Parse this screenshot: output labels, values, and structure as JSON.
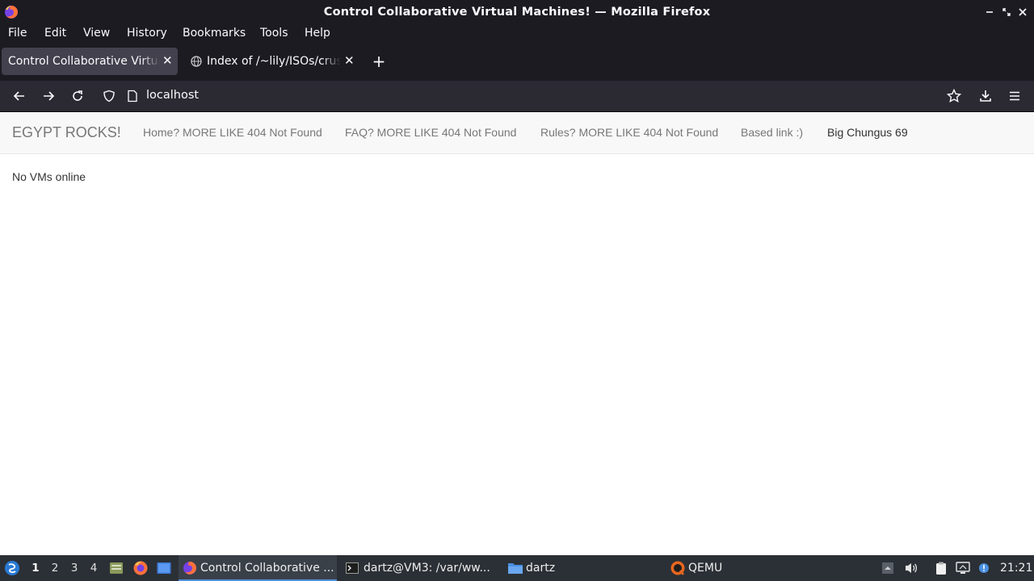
{
  "window": {
    "title": "Control Collaborative Virtual Machines! — Mozilla Firefox"
  },
  "menu": {
    "file": "File",
    "edit": "Edit",
    "view": "View",
    "history": "History",
    "bookmarks": "Bookmarks",
    "tools": "Tools",
    "help": "Help"
  },
  "tabs": [
    {
      "label": "Control Collaborative Virtual Machines!",
      "active": true
    },
    {
      "label": "Index of /~lily/ISOs/crust",
      "active": false
    }
  ],
  "urlbar": {
    "url": "localhost"
  },
  "site": {
    "brand": "EGYPT ROCKS!",
    "links": [
      "Home? MORE LIKE 404 Not Found",
      "FAQ? MORE LIKE 404 Not Found",
      "Rules? MORE LIKE 404 Not Found",
      "Based link :)",
      "Big Chungus 69"
    ],
    "status": "No VMs online"
  },
  "taskbar": {
    "workspaces": [
      "1",
      "2",
      "3",
      "4"
    ],
    "tasks": [
      "Control Collaborative ...",
      "dartz@VM3: /var/ww...",
      "dartz",
      "QEMU"
    ],
    "clock": "21:21"
  },
  "colors": {
    "chrome_dark": "#1c1b22",
    "toolbar": "#2b2a33",
    "active_tab": "#42414d",
    "taskbar": "#2b3036",
    "navbar_bg": "#f8f8f8"
  }
}
